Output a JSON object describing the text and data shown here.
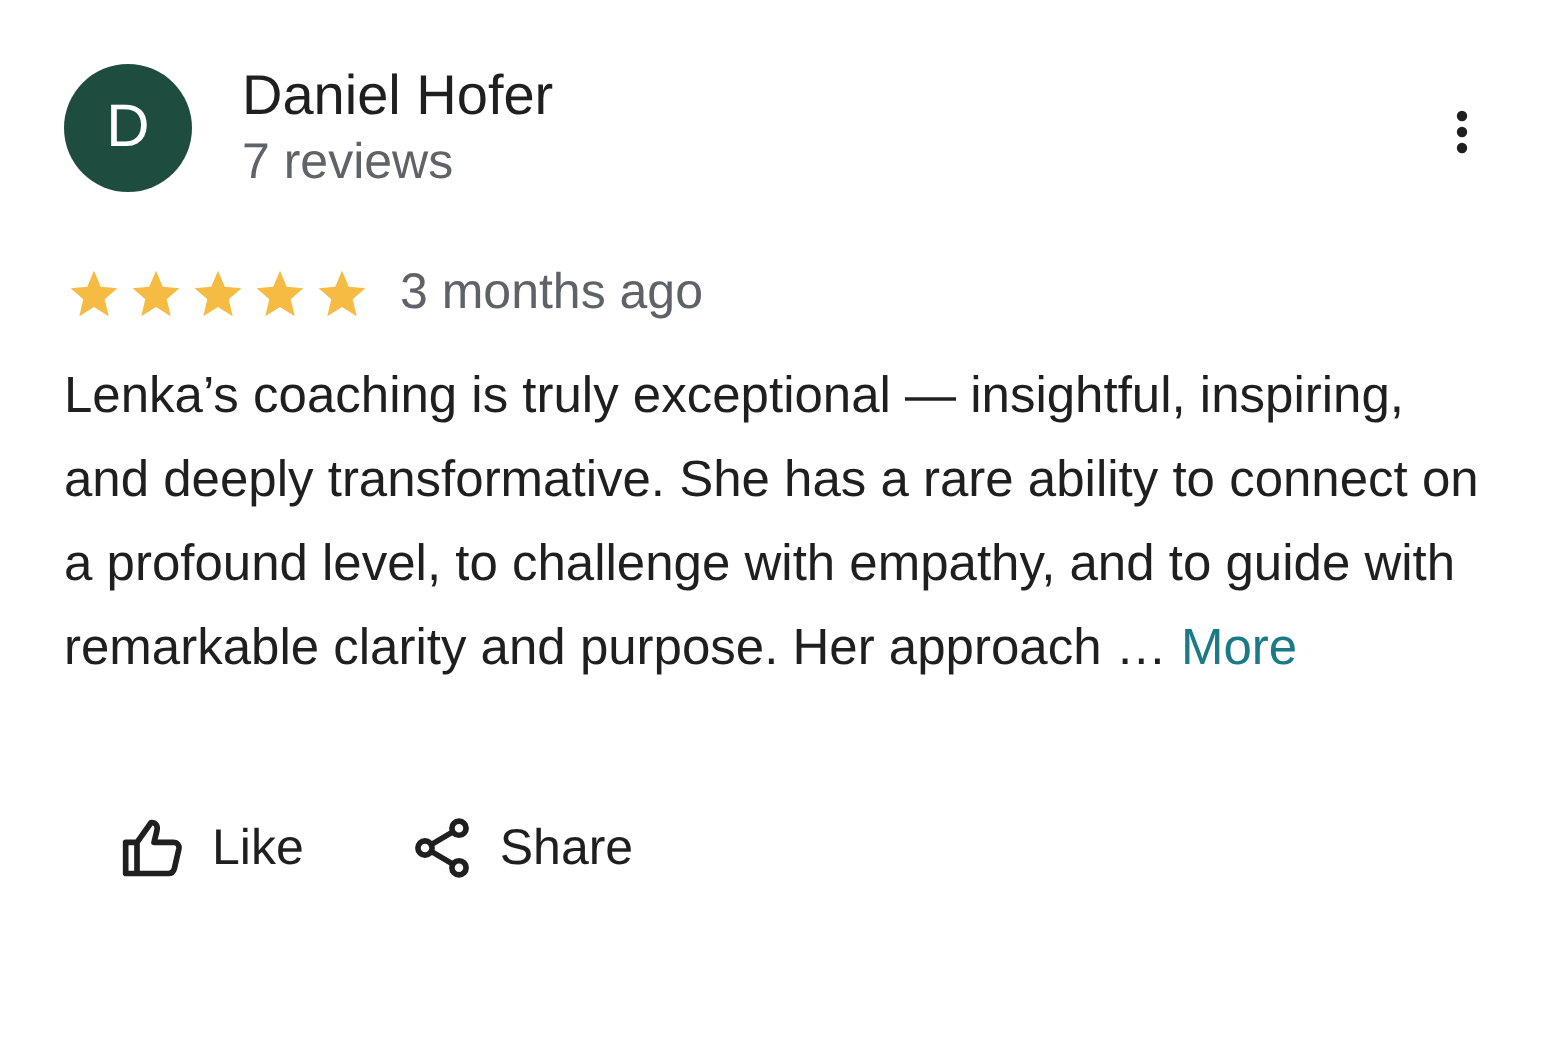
{
  "reviewer": {
    "initial": "D",
    "name": "Daniel Hofer",
    "reviews": "7 reviews"
  },
  "review": {
    "stars": 5,
    "time": "3 months ago",
    "text": "Lenka’s coaching is truly exceptional — insightful, inspiring, and deeply transformative. She has a rare ability to connect on a profound level, to challenge with empathy, and to guide with remarkable clarity and purpose. Her approach …",
    "more": "More"
  },
  "actions": [
    {
      "kind": "like",
      "label": "Like"
    },
    {
      "kind": "share",
      "label": "Share"
    }
  ]
}
